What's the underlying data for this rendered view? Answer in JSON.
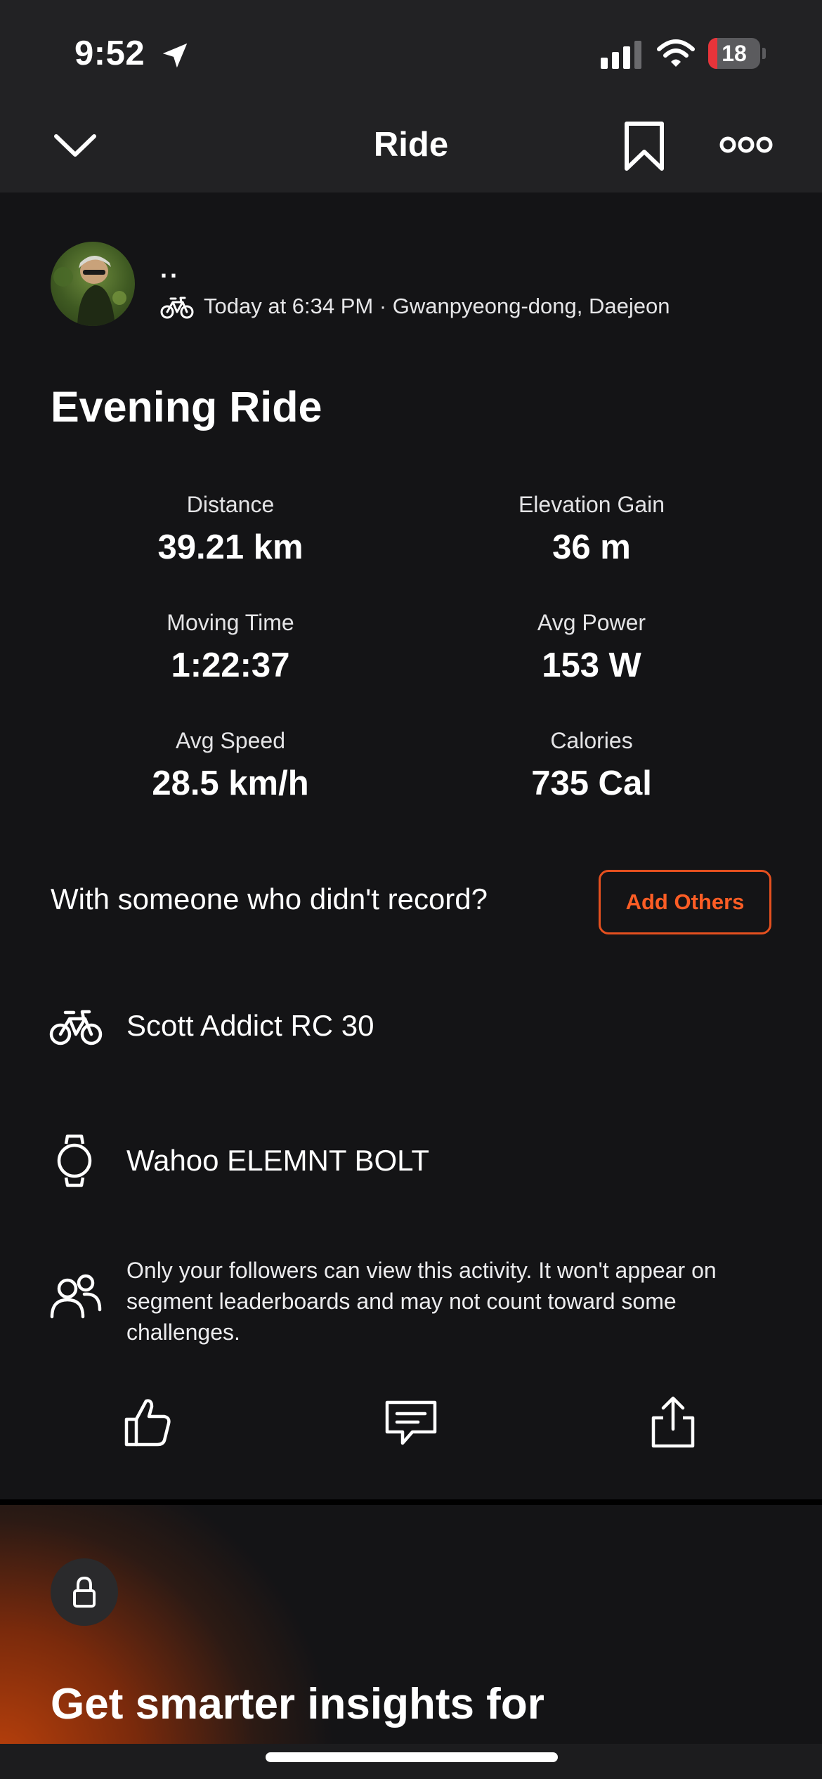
{
  "status_bar": {
    "time": "9:52",
    "battery_level": "18",
    "battery_fraction": 0.18
  },
  "nav": {
    "title": "Ride",
    "icons": [
      "chevron-down-icon",
      "bookmark-icon",
      "more-icon"
    ]
  },
  "athlete": {
    "name": "..",
    "meta": "Today at 6:34 PM · Gwanpyeong-dong, Daejeon"
  },
  "activity": {
    "title": "Evening Ride",
    "stats": [
      {
        "label": "Distance",
        "value": "39.21 km"
      },
      {
        "label": "Elevation Gain",
        "value": "36 m"
      },
      {
        "label": "Moving Time",
        "value": "1:22:37"
      },
      {
        "label": "Avg Power",
        "value": "153 W"
      },
      {
        "label": "Avg Speed",
        "value": "28.5 km/h"
      },
      {
        "label": "Calories",
        "value": "735 Cal"
      }
    ]
  },
  "with_others": {
    "question": "With someone who didn't record?",
    "button": "Add Others"
  },
  "gear": {
    "bike": "Scott Addict RC 30",
    "device": "Wahoo ELEMNT BOLT"
  },
  "privacy": {
    "text": "Only your followers can view this activity. It won't appear on segment leaderboards and may not count toward some challenges."
  },
  "actions": [
    "thumbs-up-icon",
    "comment-icon",
    "share-icon"
  ],
  "promo": {
    "title": "Get smarter insights for"
  },
  "colors": {
    "accent": "#FC5D25",
    "background": "#141416",
    "header": "#222224",
    "battery_low": "#E8343A"
  }
}
